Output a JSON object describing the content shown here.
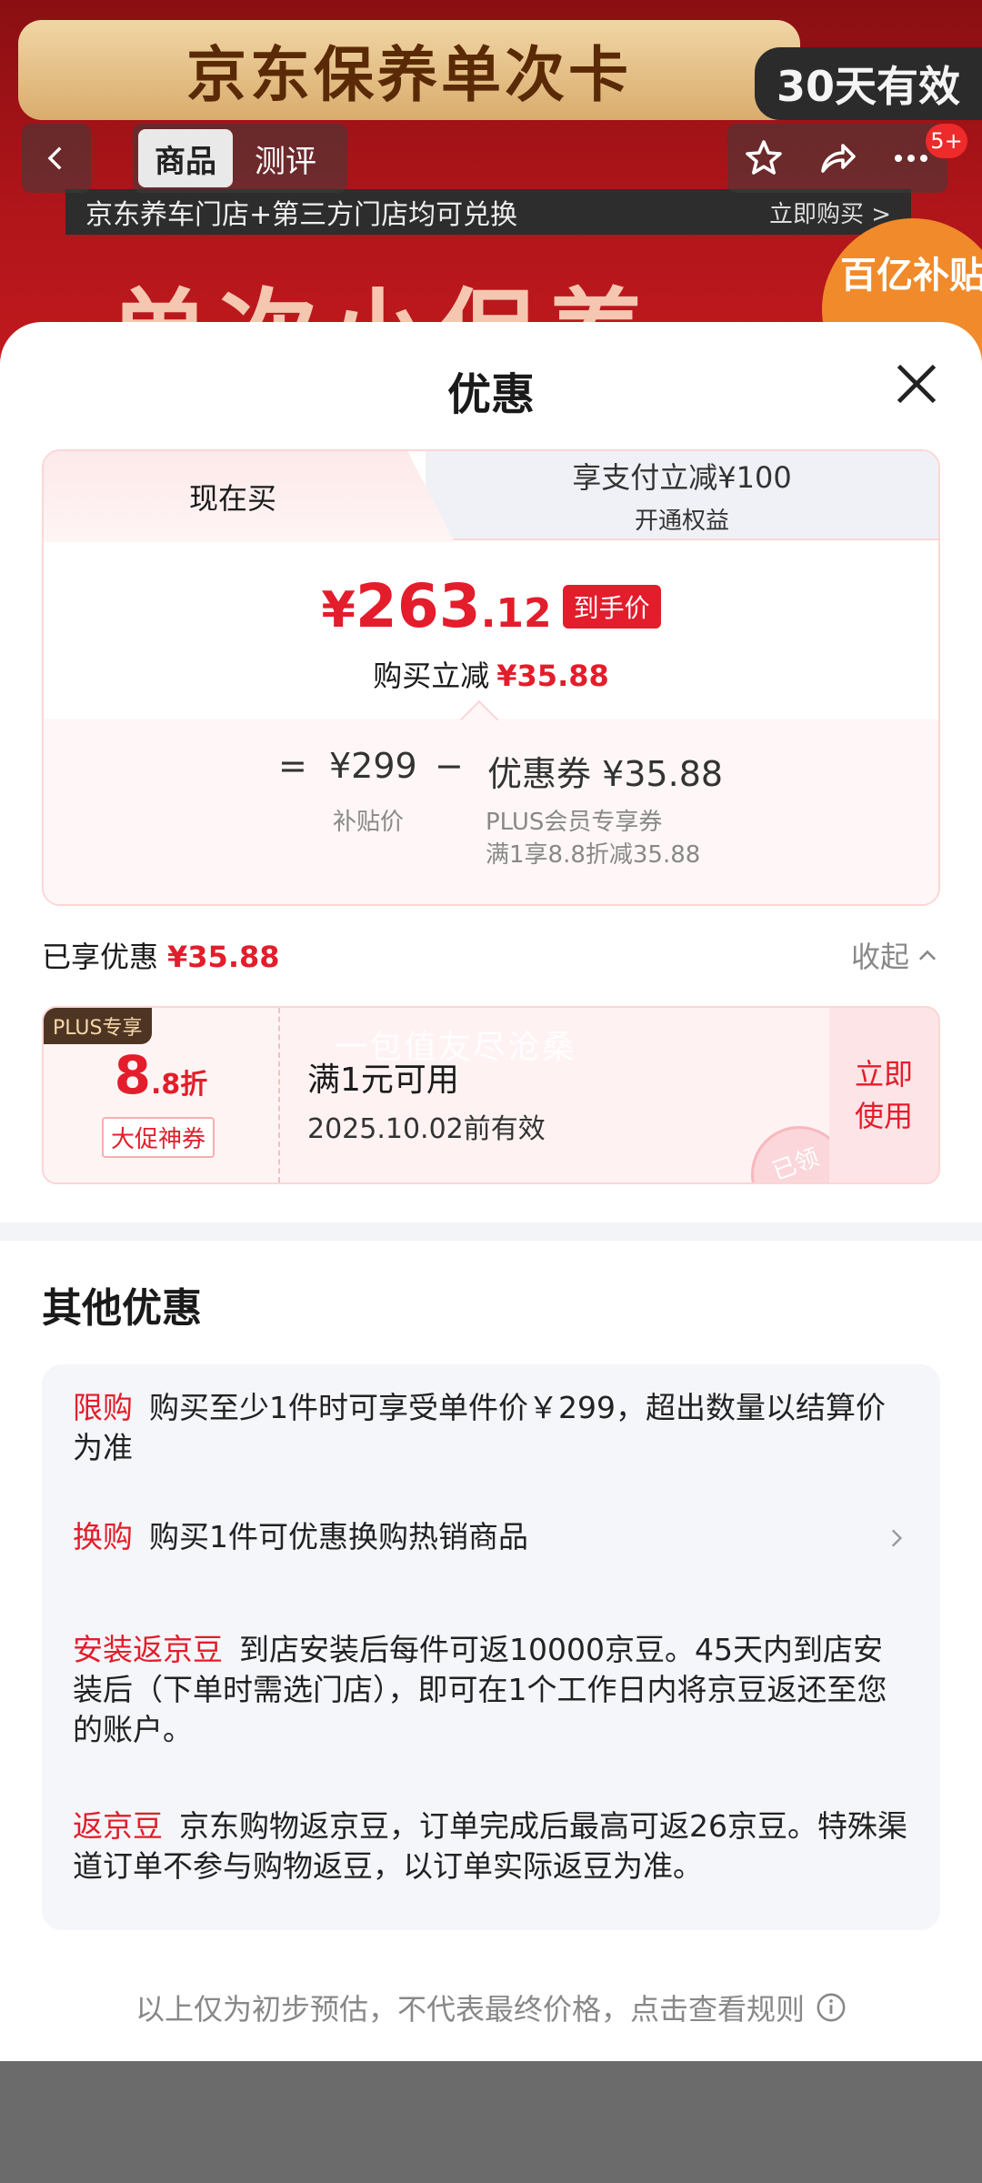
{
  "background": {
    "banner_title": "京东保养单次卡",
    "validity": "30天有效",
    "tabs": [
      {
        "label": "商品"
      },
      {
        "label": "测评"
      }
    ],
    "strip_left": "京东养车门店+第三方门店均可兑换",
    "strip_right": "立即购买 >",
    "big_text": "单次小保养",
    "badge_text": "百亿补贴",
    "message_count": "5+"
  },
  "sheet": {
    "title": "优惠",
    "tab_now": "现在买",
    "tab_pay_line1": "享支付立减¥100",
    "tab_pay_line2": "开通权益",
    "final_yuan": "¥",
    "final_int": "263",
    "final_dec": ".12",
    "final_tag": "到手价",
    "cut_label": "购买立减",
    "cut_value": "¥35.88",
    "formula_eq": "=",
    "formula_price": "¥299",
    "formula_minus": "−",
    "formula_coupon": "优惠券 ¥35.88",
    "formula_price_label": "补贴价",
    "formula_coupon_line1": "PLUS会员专享券",
    "formula_coupon_line2": "满1享8.8折减35.88",
    "enjoyed_label": "已享优惠",
    "enjoyed_value": "¥35.88",
    "collapse_label": "收起"
  },
  "coupon": {
    "plus_tag": "PLUS专享",
    "discount_big": "8",
    "discount_small": ".8折",
    "label": "大促神券",
    "condition": "满1元可用",
    "expiry": "2025.10.02前有效",
    "watermark": "一包值友尽沧桑",
    "use_line1": "立即",
    "use_line2": "使用",
    "stamp": "已领"
  },
  "other": {
    "title": "其他优惠",
    "items": [
      {
        "key": "限购",
        "text": "购买至少1件时可享受单件价￥299，超出数量以结算价为准"
      },
      {
        "key": "换购",
        "text": "购买1件可优惠换购热销商品"
      },
      {
        "key": "安装返京豆",
        "text": "到店安装后每件可返10000京豆。45天内到店安装后（下单时需选门店），即可在1个工作日内将京豆返还至您的账户。"
      },
      {
        "key": "返京豆",
        "text": "京东购物返京豆，订单完成后最高可返26京豆。特殊渠道订单不参与购物返豆，以订单实际返豆为准。"
      }
    ]
  },
  "footer_note": "以上仅为初步预估，不代表最终价格，点击查看规则",
  "colors": {
    "accent": "#e31d2b",
    "plus_dark": "#4e3523",
    "panel": "#f5f6fa"
  }
}
